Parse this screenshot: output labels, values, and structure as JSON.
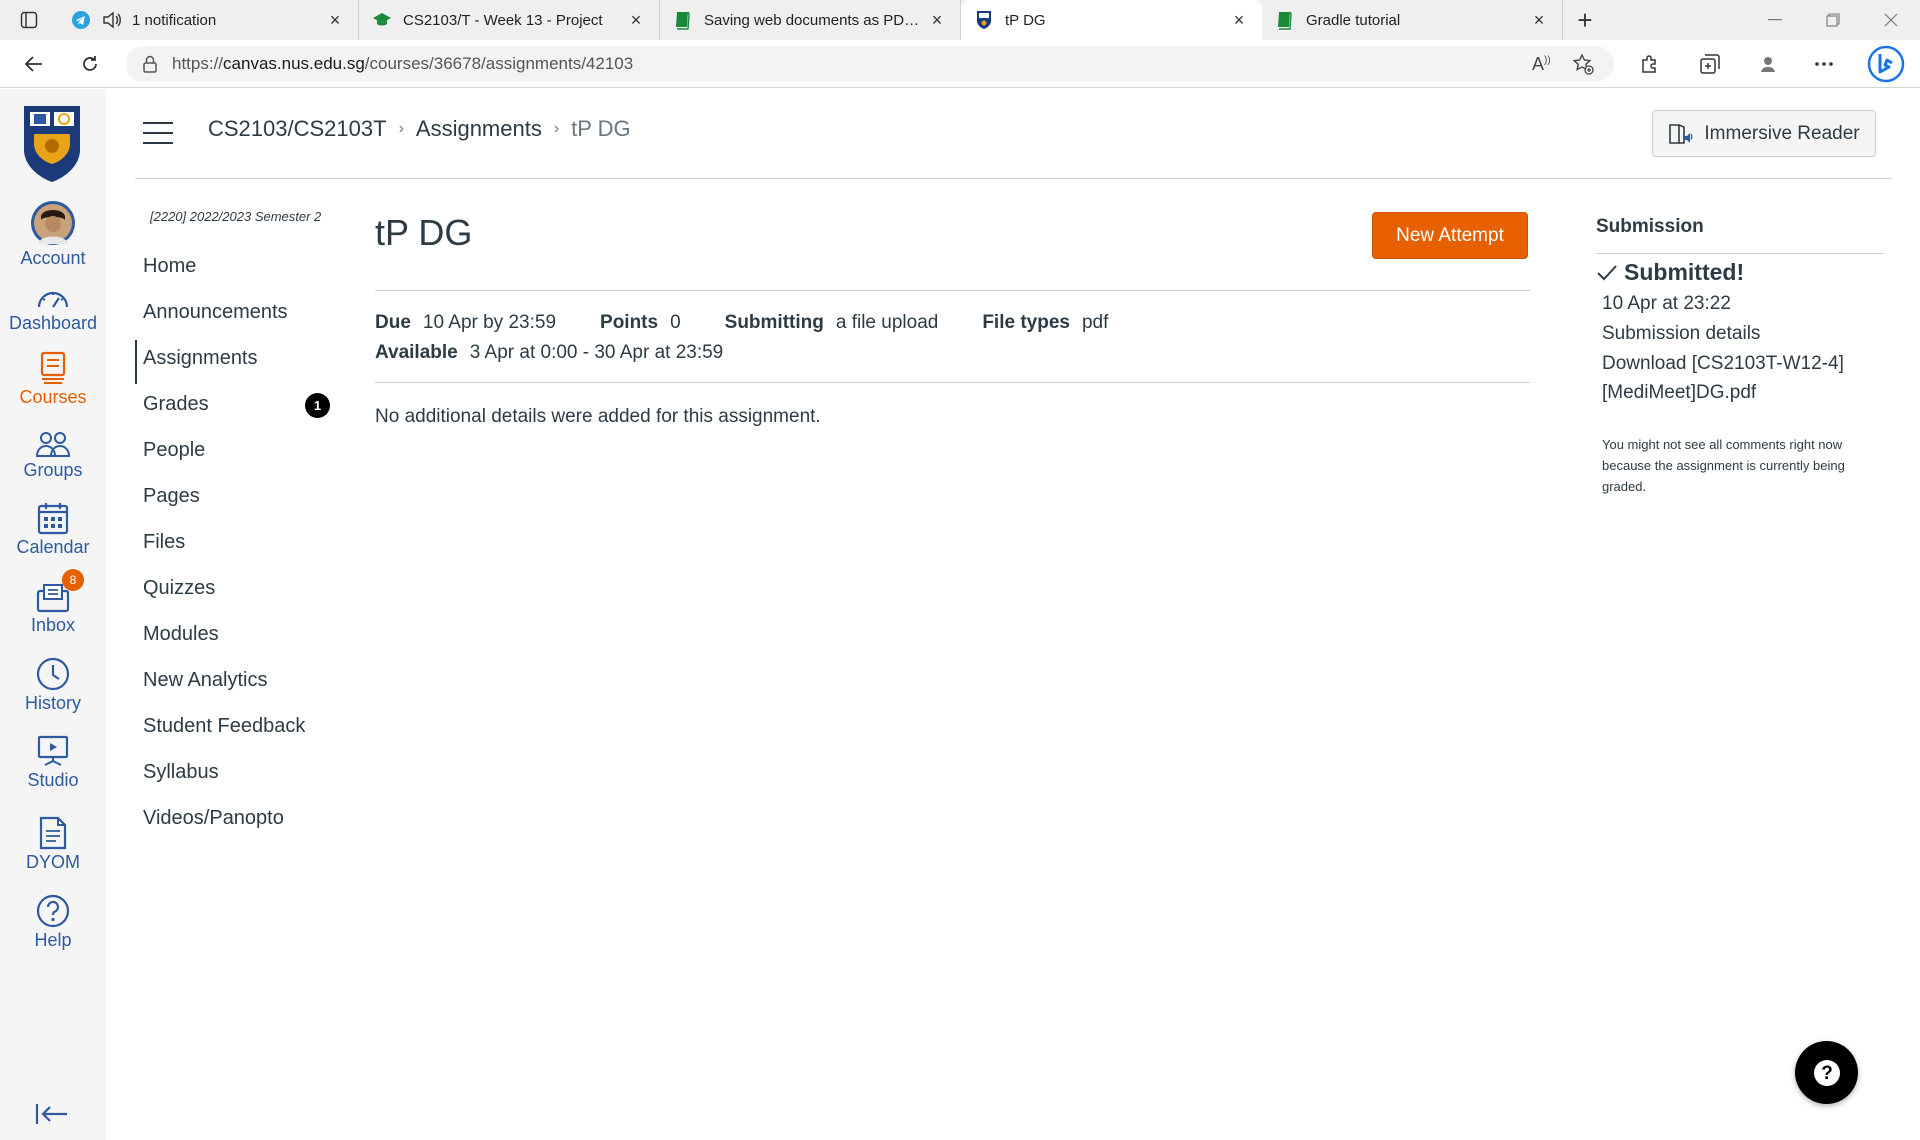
{
  "browser": {
    "tabs": [
      {
        "title": "1 notification",
        "icon": "telegram-icon"
      },
      {
        "title": "CS2103/T - Week 13 - Project",
        "icon": "graduation-cap-icon"
      },
      {
        "title": "Saving web documents as PDF fil",
        "icon": "book-icon"
      },
      {
        "title": "tP DG",
        "icon": "nus-crest-icon",
        "active": true
      },
      {
        "title": "Gradle tutorial",
        "icon": "book-icon"
      }
    ],
    "url_prefix": "https://",
    "url_host": "canvas.nus.edu.sg",
    "url_path": "/courses/36678/assignments/42103",
    "read_aloud_label": "A",
    "tab_close_glyph": "×",
    "new_tab_glyph": "+"
  },
  "global_nav": {
    "items": [
      {
        "label": "Account",
        "icon": "avatar"
      },
      {
        "label": "Dashboard",
        "icon": "dashboard-icon"
      },
      {
        "label": "Courses",
        "icon": "courses-icon",
        "active": true
      },
      {
        "label": "Groups",
        "icon": "groups-icon"
      },
      {
        "label": "Calendar",
        "icon": "calendar-icon"
      },
      {
        "label": "Inbox",
        "icon": "inbox-icon",
        "badge": "8"
      },
      {
        "label": "History",
        "icon": "history-icon"
      },
      {
        "label": "Studio",
        "icon": "studio-icon"
      },
      {
        "label": "DYOM",
        "icon": "document-icon"
      },
      {
        "label": "Help",
        "icon": "help-icon"
      }
    ],
    "active_color": "#e66000",
    "link_color": "#2d5aa0"
  },
  "header": {
    "breadcrumb": {
      "course": "CS2103/CS2103T",
      "section": "Assignments",
      "current": "tP DG",
      "separator": "›"
    },
    "immersive_reader_label": "Immersive Reader"
  },
  "course_nav": {
    "term": "[2220] 2022/2023 Semester 2",
    "items": [
      {
        "label": "Home"
      },
      {
        "label": "Announcements"
      },
      {
        "label": "Assignments",
        "active": true
      },
      {
        "label": "Grades",
        "badge": "1"
      },
      {
        "label": "People"
      },
      {
        "label": "Pages"
      },
      {
        "label": "Files"
      },
      {
        "label": "Quizzes"
      },
      {
        "label": "Modules"
      },
      {
        "label": "New Analytics"
      },
      {
        "label": "Student Feedback"
      },
      {
        "label": "Syllabus"
      },
      {
        "label": "Videos/Panopto"
      }
    ]
  },
  "assignment": {
    "title": "tP DG",
    "new_attempt_label": "New Attempt",
    "due_label": "Due",
    "due_value": "10 Apr by 23:59",
    "points_label": "Points",
    "points_value": "0",
    "submitting_label": "Submitting",
    "submitting_value": "a file upload",
    "file_types_label": "File types",
    "file_types_value": "pdf",
    "available_label": "Available",
    "available_value": "3 Apr at 0:00 - 30 Apr at 23:59",
    "description": "No additional details were added for this assignment.",
    "accent_color": "#e66000"
  },
  "submission": {
    "heading": "Submission",
    "status": "Submitted!",
    "date": "10 Apr at 23:22",
    "details_link": "Submission details",
    "download_line1": "Download [CS2103T-W12-4]",
    "download_line2": "[MediMeet]DG.pdf",
    "note": "You might not see all comments right now because the assignment is currently being graded."
  },
  "help_fab_glyph": "?"
}
